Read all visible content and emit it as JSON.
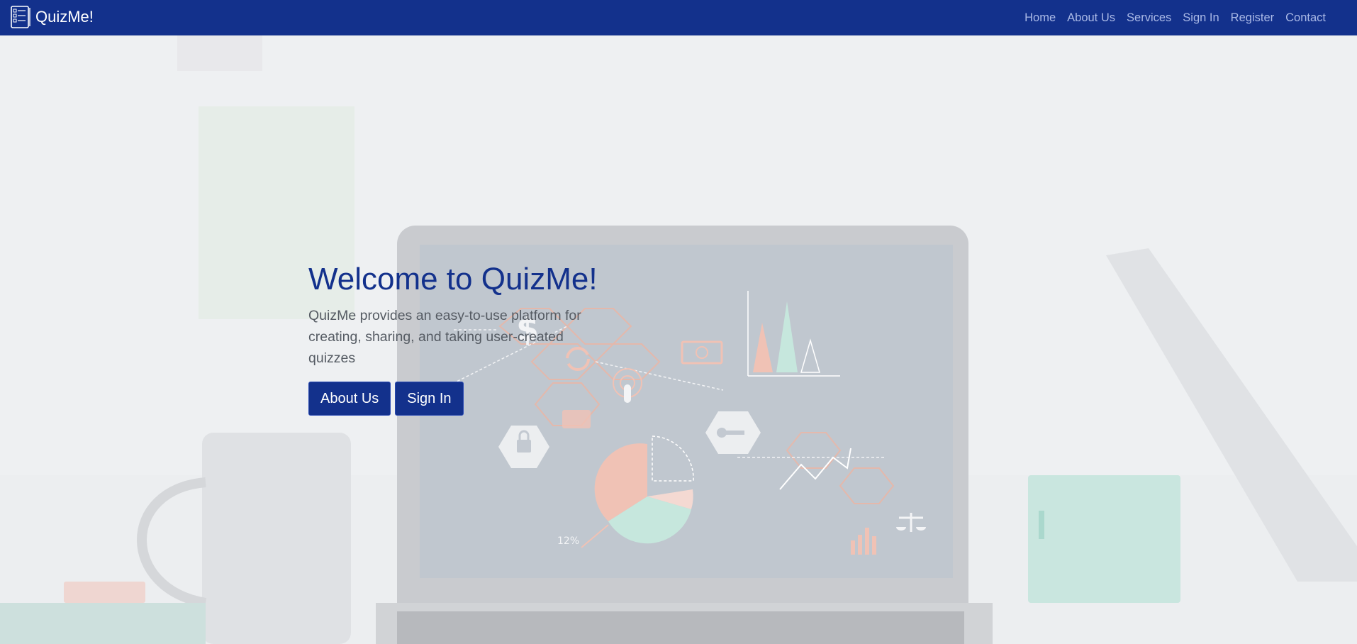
{
  "navbar": {
    "brand": "QuizMe!",
    "brand_icon": "quiz-notebook-icon",
    "links": [
      "Home",
      "About Us",
      "Services",
      "Sign In",
      "Register",
      "Contact"
    ]
  },
  "hero": {
    "title": "Welcome to QuizMe!",
    "description": "QuizMe provides an easy-to-use platform for creating, sharing, and taking user-created quizzes",
    "buttons": {
      "about": "About Us",
      "signin": "Sign In"
    },
    "laptop_screen_label": "12%"
  },
  "colors": {
    "navbar": "#13318c",
    "primary": "#13318c",
    "nav_link": "#aab9e6",
    "title": "#13318c",
    "text": "#555b63"
  }
}
